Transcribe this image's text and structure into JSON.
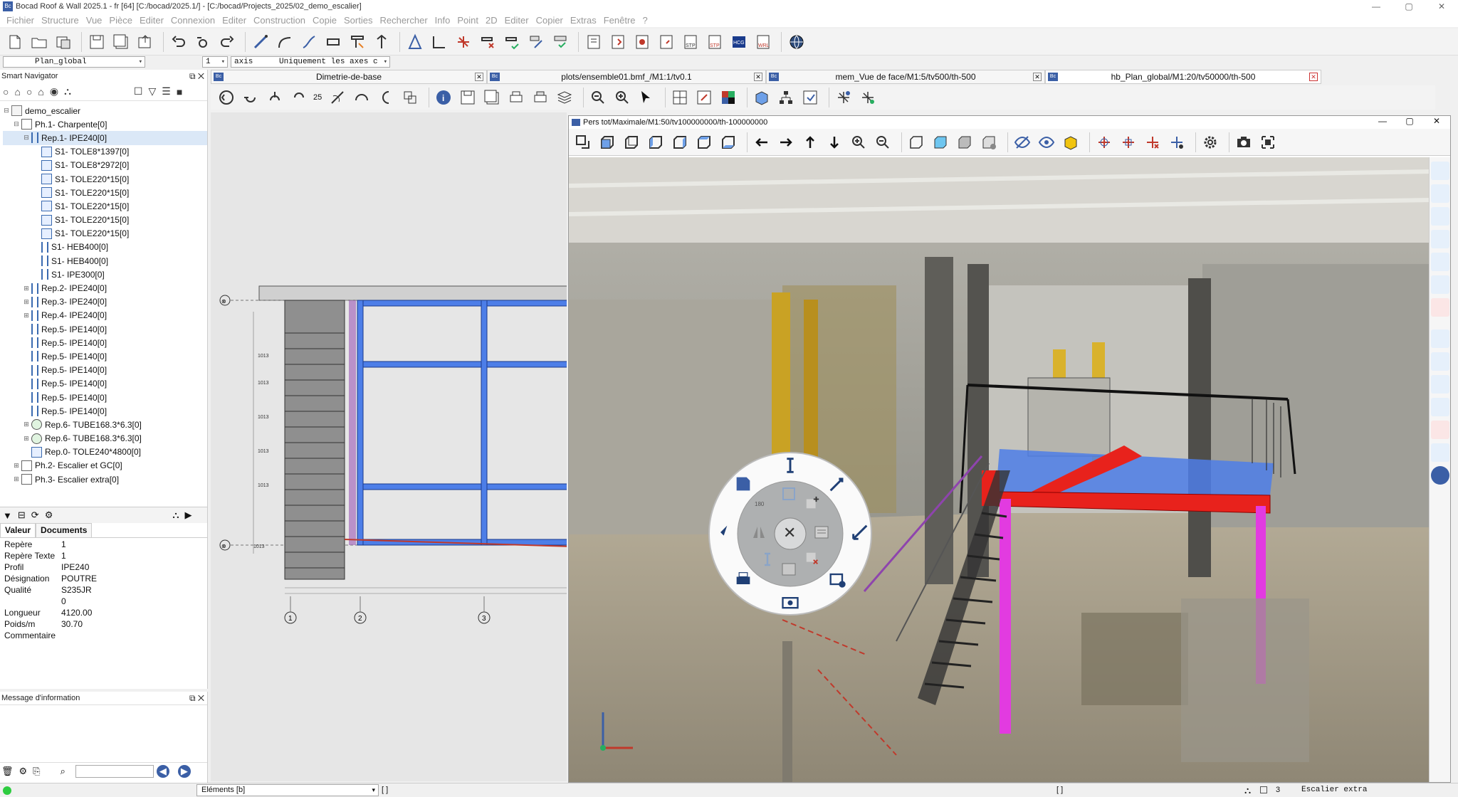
{
  "window": {
    "title": "Bocad Roof & Wall 2025.1 - fr [64]  [C:/bocad/2025.1/]  - [C:/bocad/Projects_2025/02_demo_escalier]",
    "minimize": "—",
    "maximize": "▢",
    "close": "✕"
  },
  "menu": [
    "Fichier",
    "Structure",
    "Vue",
    "Pièce",
    "Editer",
    "Connexion",
    "Editer",
    "Construction",
    "Copie",
    "Sorties",
    "Rechercher",
    "Info",
    "Point",
    "2D",
    "Editer",
    "Copier",
    "Extras",
    "Fenêtre",
    "?"
  ],
  "combos": {
    "plan": "Plan_global",
    "number": "1",
    "axis": "axis",
    "filter": "Uniquement les axes c"
  },
  "navigator": {
    "title": "Smart Navigator",
    "tree": [
      {
        "label": "demo_escalier",
        "level": 0,
        "type": "assembly",
        "expander": "⊟"
      },
      {
        "label": "Ph.1- Charpente[0]",
        "level": 1,
        "type": "phase",
        "expander": "⊟"
      },
      {
        "label": "Rep.1- IPE240[0]",
        "level": 2,
        "type": "beam",
        "expander": "⊟",
        "selected": true
      },
      {
        "label": "S1- TOLE8*1397[0]",
        "level": 3,
        "type": "plate",
        "expander": ""
      },
      {
        "label": "S1- TOLE8*2972[0]",
        "level": 3,
        "type": "plate",
        "expander": ""
      },
      {
        "label": "S1- TOLE220*15[0]",
        "level": 3,
        "type": "plate",
        "expander": ""
      },
      {
        "label": "S1- TOLE220*15[0]",
        "level": 3,
        "type": "plate",
        "expander": ""
      },
      {
        "label": "S1- TOLE220*15[0]",
        "level": 3,
        "type": "plate",
        "expander": ""
      },
      {
        "label": "S1- TOLE220*15[0]",
        "level": 3,
        "type": "plate",
        "expander": ""
      },
      {
        "label": "S1- TOLE220*15[0]",
        "level": 3,
        "type": "plate",
        "expander": ""
      },
      {
        "label": "S1- HEB400[0]",
        "level": 3,
        "type": "beam",
        "expander": ""
      },
      {
        "label": "S1- HEB400[0]",
        "level": 3,
        "type": "beam",
        "expander": ""
      },
      {
        "label": "S1- IPE300[0]",
        "level": 3,
        "type": "beam",
        "expander": ""
      },
      {
        "label": "Rep.2- IPE240[0]",
        "level": 2,
        "type": "beam",
        "expander": "⊞"
      },
      {
        "label": "Rep.3- IPE240[0]",
        "level": 2,
        "type": "beam",
        "expander": "⊞"
      },
      {
        "label": "Rep.4- IPE240[0]",
        "level": 2,
        "type": "beam",
        "expander": "⊞"
      },
      {
        "label": "Rep.5- IPE140[0]",
        "level": 2,
        "type": "beam",
        "expander": ""
      },
      {
        "label": "Rep.5- IPE140[0]",
        "level": 2,
        "type": "beam",
        "expander": ""
      },
      {
        "label": "Rep.5- IPE140[0]",
        "level": 2,
        "type": "beam",
        "expander": ""
      },
      {
        "label": "Rep.5- IPE140[0]",
        "level": 2,
        "type": "beam",
        "expander": ""
      },
      {
        "label": "Rep.5- IPE140[0]",
        "level": 2,
        "type": "beam",
        "expander": ""
      },
      {
        "label": "Rep.5- IPE140[0]",
        "level": 2,
        "type": "beam",
        "expander": ""
      },
      {
        "label": "Rep.5- IPE140[0]",
        "level": 2,
        "type": "beam",
        "expander": ""
      },
      {
        "label": "Rep.6- TUBE168.3*6.3[0]",
        "level": 2,
        "type": "tube",
        "expander": "⊞"
      },
      {
        "label": "Rep.6- TUBE168.3*6.3[0]",
        "level": 2,
        "type": "tube",
        "expander": "⊞"
      },
      {
        "label": "Rep.0- TOLE240*4800[0]",
        "level": 2,
        "type": "plate",
        "expander": ""
      },
      {
        "label": "Ph.2- Escalier et GC[0]",
        "level": 1,
        "type": "phase",
        "expander": "⊞"
      },
      {
        "label": "Ph.3- Escalier extra[0]",
        "level": 1,
        "type": "phase",
        "expander": "⊞"
      }
    ]
  },
  "properties": {
    "tabs": [
      "Valeur",
      "Documents"
    ],
    "rows": [
      {
        "key": "Repère",
        "value": "1"
      },
      {
        "key": "Repère Texte",
        "value": "1"
      },
      {
        "key": "Profil",
        "value": "IPE240"
      },
      {
        "key": "Désignation",
        "value": "POUTRE"
      },
      {
        "key": "Qualité",
        "value": "S235JR"
      },
      {
        "key": "",
        "value": "0"
      },
      {
        "key": "Longueur",
        "value": "4120.00"
      },
      {
        "key": "Poids/m",
        "value": "30.70"
      },
      {
        "key": "Commentaire",
        "value": ""
      }
    ]
  },
  "messages": {
    "title": "Message d'information",
    "prev": "◀",
    "next": "▶"
  },
  "doc_tabs": [
    {
      "label": "Dimetrie-de-base",
      "active": false
    },
    {
      "label": "plots/ensemble01.bmf_/M1:1/tv0.1",
      "active": false
    },
    {
      "label": "mem_Vue de face/M1:5/tv500/th-500",
      "active": false
    },
    {
      "label": "hb_Plan_global/M1:20/tv50000/th-500",
      "active": true
    }
  ],
  "drawtools": {
    "zoom_value": "25"
  },
  "drawing": {
    "axis_labels": [
      "1",
      "2",
      "3"
    ],
    "grid_markers": [
      "⊗",
      "⊗"
    ]
  },
  "view3d": {
    "title": "Pers tot/Maximale/M1:50/tv100000000/th-100000000",
    "minimize": "—",
    "maximize": "▢",
    "close": "✕"
  },
  "radial_menu": {
    "center": "✕",
    "scale_text": "180"
  },
  "status": {
    "elements_combo": "Eléments [b]",
    "bracket_1": "[ ]",
    "bracket_2": "[ ]",
    "phase_number": "3",
    "phase_name": "Escalier extra"
  },
  "colors": {
    "accent": "#3b5fa6",
    "beam_blue": "#4d7ee8",
    "beam_red": "#e8221c",
    "stair_magenta": "#e23be0",
    "status_green": "#2ecc40"
  }
}
